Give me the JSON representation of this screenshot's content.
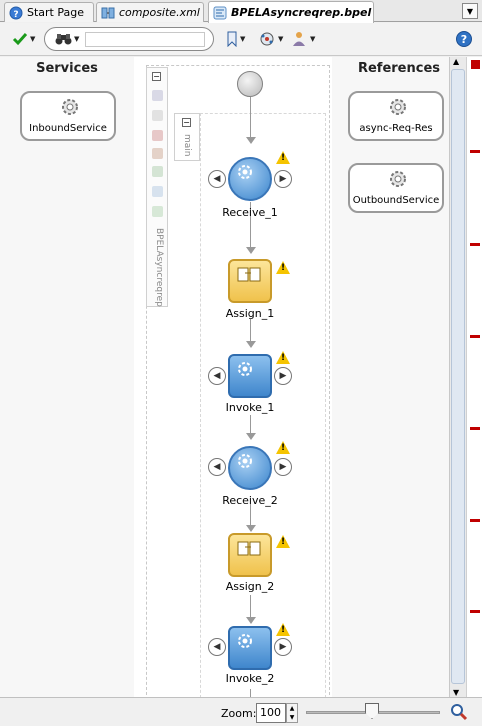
{
  "tabs": [
    {
      "label": "Start Page",
      "icon": "help-circle-icon",
      "active": false
    },
    {
      "label": "composite.xml",
      "icon": "composite-icon",
      "active": false
    },
    {
      "label": "BPELAsyncreqrep.bpel",
      "icon": "bpel-icon",
      "active": true
    }
  ],
  "toolbar": {
    "search_value": "",
    "help_label": "?"
  },
  "services": {
    "title": "Services",
    "items": [
      {
        "label": "InboundService"
      }
    ]
  },
  "references": {
    "title": "References",
    "items": [
      {
        "label": "async-Req-Res"
      },
      {
        "label": "OutboundService"
      }
    ]
  },
  "process": {
    "scope_label": "BPELAsyncreqrep",
    "sequence_label": "main",
    "activities": [
      {
        "label": "Receive_1",
        "type": "receive"
      },
      {
        "label": "Assign_1",
        "type": "assign"
      },
      {
        "label": "Invoke_1",
        "type": "invoke"
      },
      {
        "label": "Receive_2",
        "type": "receive"
      },
      {
        "label": "Assign_2",
        "type": "assign"
      },
      {
        "label": "Invoke_2",
        "type": "invoke"
      }
    ],
    "warning_glyph": "!"
  },
  "status": {
    "zoom_label": "Zoom:",
    "zoom_value": "100"
  },
  "colors": {
    "accent": "#3a84cc",
    "warning": "#f5c400",
    "error_marker": "#c00000",
    "assign": "#f0c24c"
  }
}
